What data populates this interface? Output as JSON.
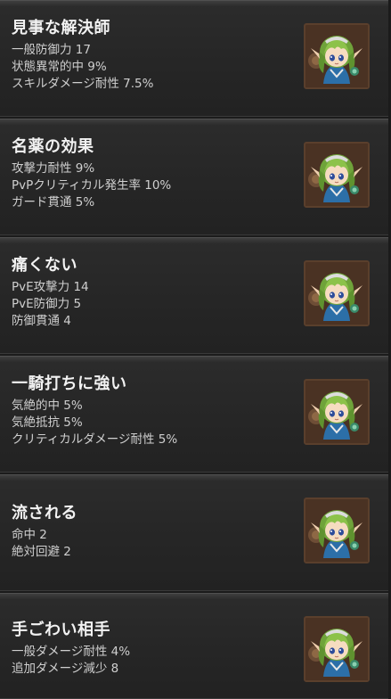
{
  "cards": [
    {
      "title": "見事な解決師",
      "stats": [
        "一般防御力 17",
        "状態異常的中 9%",
        "スキルダメージ耐性 7.5%"
      ],
      "icon": "character-portrait-icon"
    },
    {
      "title": "名薬の効果",
      "stats": [
        "攻撃力耐性 9%",
        "PvPクリティカル発生率 10%",
        "ガード貫通 5%"
      ],
      "icon": "character-portrait-icon"
    },
    {
      "title": "痛くない",
      "stats": [
        "PvE攻撃力 14",
        "PvE防御力 5",
        "防御貫通 4"
      ],
      "icon": "character-portrait-icon"
    },
    {
      "title": "一騎打ちに強い",
      "stats": [
        "気絶的中 5%",
        "気絶抵抗 5%",
        "クリティカルダメージ耐性 5%"
      ],
      "icon": "character-portrait-icon"
    },
    {
      "title": "流される",
      "stats": [
        "命中 2",
        "絶対回避 2"
      ],
      "icon": "character-portrait-icon"
    },
    {
      "title": "手ごわい相手",
      "stats": [
        "一般ダメージ耐性 4%",
        "追加ダメージ減少 8"
      ],
      "icon": "character-portrait-icon"
    }
  ]
}
